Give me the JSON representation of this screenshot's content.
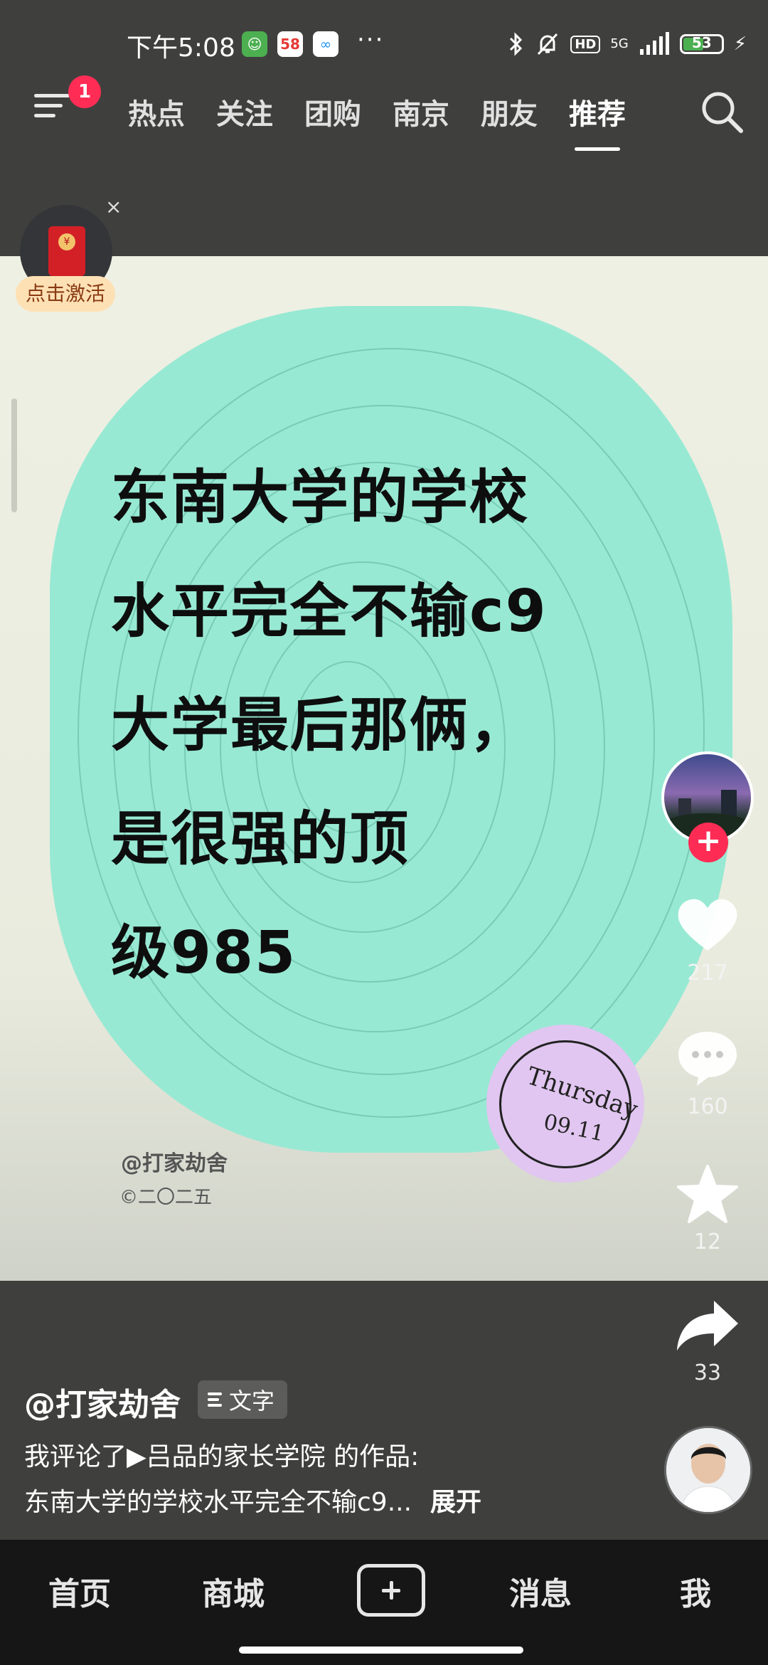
{
  "status_bar": {
    "time": "下午5:08",
    "app_icons": [
      {
        "name": "green-app-icon",
        "glyph": "☺",
        "color": "#4caf50"
      },
      {
        "name": "58-app-icon",
        "glyph": "58",
        "color": "#ffffff"
      },
      {
        "name": "cloud-app-icon",
        "glyph": "∞",
        "color": "#ffffff"
      }
    ],
    "more": "···",
    "hd": "HD",
    "network": "5G",
    "battery": "53",
    "battery_level": 0.53
  },
  "top_nav": {
    "badge": "1",
    "tabs": [
      "热点",
      "关注",
      "团购",
      "南京",
      "朋友",
      "推荐"
    ],
    "active_tab": "推荐"
  },
  "red_packet": {
    "activate_label": "点击激活",
    "close": "×",
    "seal": "¥"
  },
  "post": {
    "text_lines": [
      "东南大学的学校",
      "水平完全不输c9",
      "大学最后那俩，",
      "是很强的顶",
      "级985"
    ],
    "date_day": "Thursday",
    "date_num": "09.11",
    "watermark": "@打家劫舍",
    "copyright": "©二〇二五"
  },
  "actions": {
    "follow": "+",
    "like_count": "217",
    "comment_count": "160",
    "favorite_count": "12",
    "share_count": "33"
  },
  "caption": {
    "author": "@打家劫舍",
    "tag": "文字",
    "line1": "我评论了▶吕品的家长学院 的作品:",
    "line2": "东南大学的学校水平完全不输c9...",
    "expand": "展开"
  },
  "bottom_nav": {
    "home": "首页",
    "mall": "商城",
    "messages": "消息",
    "me": "我"
  },
  "colors": {
    "blob": "#98e9d3",
    "accent": "#fe2c55",
    "date_circle": "#e0c6f0"
  }
}
